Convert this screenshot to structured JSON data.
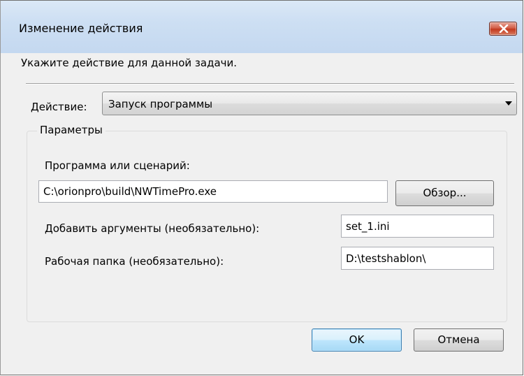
{
  "window": {
    "title": "Изменение действия"
  },
  "instruction": "Укажите действие для данной задачи.",
  "action": {
    "label": "Действие:",
    "selected": "Запуск программы"
  },
  "parameters": {
    "title": "Параметры",
    "program_label": "Программа или сценарий:",
    "program_value": "C:\\orionpro\\build\\NWTimePro.exe",
    "browse_label": "Обзор...",
    "args_label": "Добавить аргументы (необязательно):",
    "args_value": "set_1.ini",
    "workdir_label": "Рабочая папка (необязательно):",
    "workdir_value": "D:\\testshablon\\"
  },
  "buttons": {
    "ok": "OK",
    "cancel": "Отмена"
  }
}
